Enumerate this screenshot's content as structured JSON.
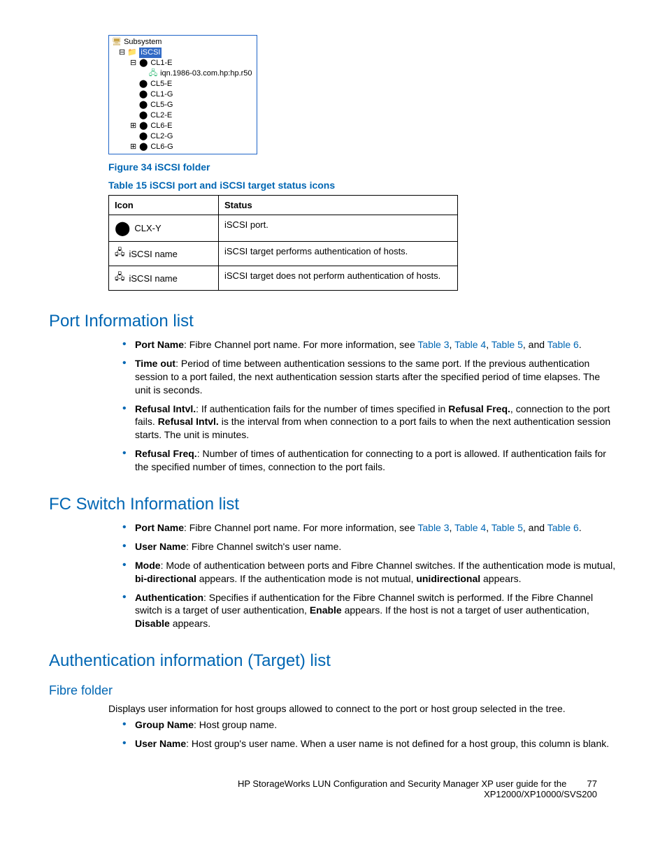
{
  "tree": {
    "root": "Subsystem",
    "folder": "iSCSI",
    "items": [
      "CL1-E",
      "iqn.1986-03.com.hp:hp.r50",
      "CL5-E",
      "CL1-G",
      "CL5-G",
      "CL2-E",
      "CL6-E",
      "CL2-G",
      "CL6-G"
    ]
  },
  "figure_caption": "Figure 34 iSCSI folder",
  "table_caption": "Table 15 iSCSI port and iSCSI target status icons",
  "table": {
    "headers": {
      "icon": "Icon",
      "status": "Status"
    },
    "rows": [
      {
        "icon_label": "CLX-Y",
        "status": "iSCSI port."
      },
      {
        "icon_label": "iSCSI name",
        "status": "iSCSI target performs authentication of hosts."
      },
      {
        "icon_label": "iSCSI name",
        "status": "iSCSI target does not perform authentication of hosts."
      }
    ]
  },
  "sections": {
    "port_info": {
      "title": "Port Information list",
      "items": {
        "b0": {
          "label": "Port Name",
          "text_before": ": Fibre Channel port name. For more information, see ",
          "link1": "Table 3",
          "sep1": ", ",
          "link2": "Table 4",
          "sep2": ", ",
          "link3": "Table 5",
          "sep3": ", and ",
          "link4": "Table 6",
          "tail": "."
        },
        "b1": {
          "label": "Time out",
          "text": ": Period of time between authentication sessions to the same port. If the previous authentication session to a port failed, the next authentication session starts after the specified period of time elapses. The unit is seconds."
        },
        "b2": {
          "label": "Refusal Intvl.",
          "t1": ": If authentication fails for the number of times specified in ",
          "b2b": "Refusal Freq.",
          "t2": ", connection to the port fails. ",
          "b2c": "Refusal Intvl.",
          "t3": " is the interval from when connection to a port fails to when the next authentication session starts. The unit is minutes."
        },
        "b3": {
          "label": "Refusal Freq.",
          "text": ": Number of times of authentication for connecting to a port is allowed. If authentication fails for the specified number of times, connection to the port fails."
        }
      }
    },
    "fc_switch": {
      "title": "FC Switch Information list",
      "items": {
        "b0": {
          "label": "Port Name",
          "text_before": ": Fibre Channel port name. For more information, see ",
          "link1": "Table 3",
          "sep1": ", ",
          "link2": "Table 4",
          "sep2": ", ",
          "link3": "Table 5",
          "sep3": ", and ",
          "link4": "Table 6",
          "tail": "."
        },
        "b1": {
          "label": "User Name",
          "text": ": Fibre Channel switch's user name."
        },
        "b2": {
          "label": "Mode",
          "t1": ": Mode of authentication between ports and Fibre Channel switches. If the authentication mode is mutual, ",
          "bi": "bi-directional",
          "t2": " appears. If the authentication mode is not mutual, ",
          "uni": "unidirectional",
          "t3": " appears."
        },
        "b3": {
          "label": "Authentication",
          "t1": ": Specifies if authentication for the Fibre Channel switch is performed. If the Fibre Channel switch is a target of user authentication, ",
          "en": "Enable",
          "t2": " appears. If the host is not a target of user authentication, ",
          "dis": "Disable",
          "t3": " appears."
        }
      }
    },
    "auth_target": {
      "title": "Authentication information (Target) list",
      "sub": "Fibre folder",
      "intro": "Displays user information for host groups allowed to connect to the port or host group selected in the tree.",
      "items": {
        "b0": {
          "label": "Group Name",
          "text": ": Host group name."
        },
        "b1": {
          "label": "User Name",
          "text": ": Host group's user name. When a user name is not defined for a host group, this column is blank."
        }
      }
    }
  },
  "footer": {
    "line1": "HP StorageWorks LUN Configuration and Security Manager XP user guide for the",
    "line2": "XP12000/XP10000/SVS200",
    "page": "77"
  }
}
